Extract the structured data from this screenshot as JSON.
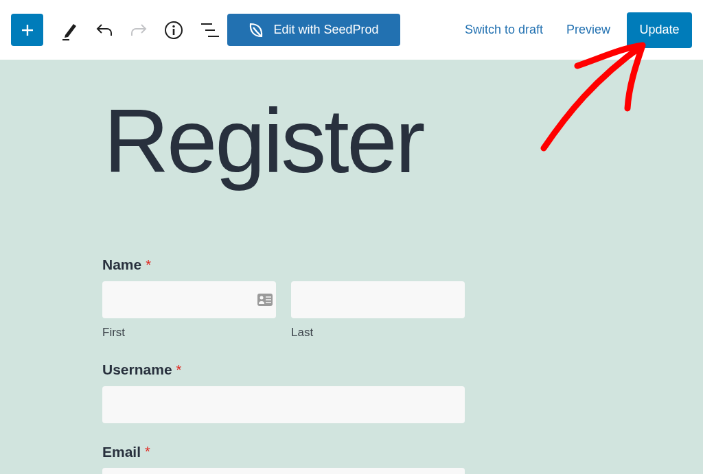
{
  "toolbar": {
    "tools": [
      {
        "kind": "add",
        "disabled": false
      },
      {
        "kind": "pen",
        "disabled": false
      },
      {
        "kind": "undo",
        "disabled": false
      },
      {
        "kind": "redo",
        "disabled": true
      },
      {
        "kind": "info",
        "disabled": false
      },
      {
        "kind": "outline",
        "disabled": false
      }
    ],
    "seedprod_button": "Edit with SeedProd",
    "links": [
      "Switch to draft",
      "Preview"
    ],
    "update_button": "Update"
  },
  "page": {
    "title": "Register",
    "fields": [
      {
        "kind": "name",
        "label": "Name",
        "required_mark": "*",
        "sublabels": [
          "First",
          "Last"
        ]
      },
      {
        "kind": "text",
        "label": "Username",
        "required_mark": "*"
      },
      {
        "kind": "text",
        "label": "Email",
        "required_mark": "*"
      }
    ]
  }
}
